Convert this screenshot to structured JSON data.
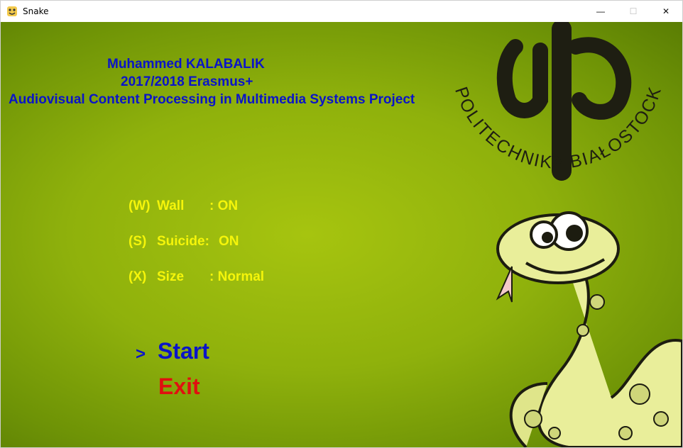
{
  "window": {
    "title": "Snake",
    "minimize_glyph": "—",
    "maximize_glyph": "☐",
    "close_glyph": "✕"
  },
  "header": {
    "author": "Muhammed KALABALIK",
    "program": "2017/2018 Erasmus+",
    "project": "Audiovisual Content Processing in Multimedia Systems Project"
  },
  "options": [
    {
      "key": "(W)",
      "name": "Wall",
      "value": ": ON"
    },
    {
      "key": "(S)",
      "name": "Suicide:",
      "value": "ON"
    },
    {
      "key": "(X)",
      "name": "Size",
      "value": ": Normal"
    }
  ],
  "menu": {
    "selector": ">",
    "start": "Start",
    "exit": "Exit"
  },
  "logo": {
    "text": "POLITECHNIKA BIAŁOSTOCKA"
  },
  "colors": {
    "background": "#8fb10c",
    "header_text": "#0a14c8",
    "option_text": "#f5f50a",
    "exit_text": "#e01010"
  }
}
